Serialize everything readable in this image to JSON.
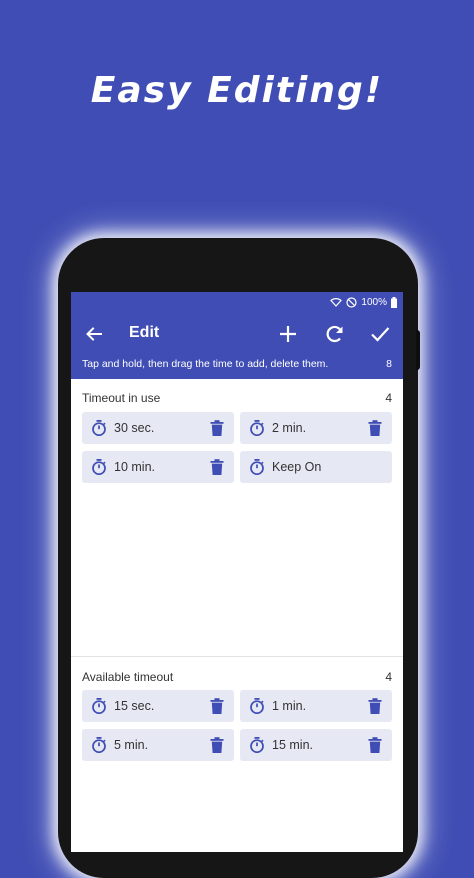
{
  "headline": "Easy Editing!",
  "status": {
    "battery": "100%"
  },
  "toolbar": {
    "title": "Edit",
    "back_icon": "arrow-left-icon",
    "add_icon": "plus-icon",
    "refresh_icon": "refresh-icon",
    "confirm_icon": "check-icon"
  },
  "hint": {
    "text": "Tap and hold, then drag the time to add, delete them.",
    "count": "8"
  },
  "in_use": {
    "title": "Timeout in use",
    "count": "4",
    "items": [
      {
        "label": "30 sec.",
        "deletable": true
      },
      {
        "label": "2 min.",
        "deletable": true
      },
      {
        "label": "10 min.",
        "deletable": true
      },
      {
        "label": "Keep On",
        "deletable": false
      }
    ]
  },
  "available": {
    "title": "Available timeout",
    "count": "4",
    "items": [
      {
        "label": "15 sec.",
        "deletable": true
      },
      {
        "label": "1 min.",
        "deletable": true
      },
      {
        "label": "5 min.",
        "deletable": true
      },
      {
        "label": "15 min.",
        "deletable": true
      }
    ]
  },
  "colors": {
    "primary": "#3f4db4",
    "chip": "#e6e8f3",
    "icon": "#3f4db4"
  }
}
